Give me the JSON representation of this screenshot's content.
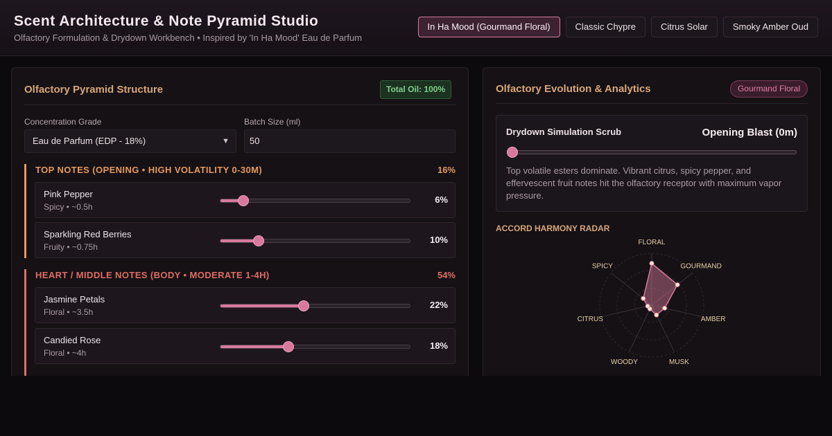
{
  "header": {
    "title": "Scent Architecture & Note Pyramid Studio",
    "subtitle": "Olfactory Formulation & Drydown Workbench • Inspired by 'In Ha Mood' Eau de Parfum",
    "presets": [
      {
        "label": "In Ha Mood (Gourmand Floral)",
        "active": true
      },
      {
        "label": "Classic Chypre",
        "active": false
      },
      {
        "label": "Citrus Solar",
        "active": false
      },
      {
        "label": "Smoky Amber Oud",
        "active": false
      }
    ]
  },
  "pyramid": {
    "title": "Olfactory Pyramid Structure",
    "total_oil": "Total Oil: 100%",
    "concentration_label": "Concentration Grade",
    "concentration_value": "Eau de Parfum (EDP - 18%)",
    "batch_label": "Batch Size (ml)",
    "batch_value": "50",
    "tiers": [
      {
        "title": "TOP NOTES (OPENING • HIGH VOLATILITY 0-30M)",
        "pct": "16%",
        "color": "#e59a5c",
        "notes": [
          {
            "name": "Pink Pepper",
            "meta": "Spicy • ~0.5h",
            "pct_label": "6%",
            "value": 6,
            "max": 50
          },
          {
            "name": "Sparkling Red Berries",
            "meta": "Fruity • ~0.75h",
            "pct_label": "10%",
            "value": 10,
            "max": 50
          }
        ]
      },
      {
        "title": "HEART / MIDDLE NOTES (BODY • MODERATE 1-4H)",
        "pct": "54%",
        "color": "#e06e63",
        "notes": [
          {
            "name": "Jasmine Petals",
            "meta": "Floral • ~3.5h",
            "pct_label": "22%",
            "value": 22,
            "max": 50
          },
          {
            "name": "Candied Rose",
            "meta": "Floral • ~4h",
            "pct_label": "18%",
            "value": 18,
            "max": 50
          }
        ]
      }
    ]
  },
  "analytics": {
    "title": "Olfactory Evolution & Analytics",
    "mood_badge": "Gourmand Floral",
    "scrub": {
      "title": "Drydown Simulation Scrub",
      "phase": "Opening Blast (0m)",
      "position": 0,
      "description": "Top volatile esters dominate. Vibrant citrus, spicy pepper, and effervescent fruit notes hit the olfactory receptor with maximum vapor pressure."
    },
    "radar": {
      "heading": "ACCORD HARMONY RADAR",
      "axes": [
        "FLORAL",
        "GOURMAND",
        "AMBER",
        "MUSK",
        "WOODY",
        "CITRUS",
        "SPICY"
      ],
      "values": [
        0.79,
        0.6,
        0.19,
        0.14,
        0.0,
        0.0,
        0.14
      ],
      "fill_color": "#d8799c"
    }
  }
}
